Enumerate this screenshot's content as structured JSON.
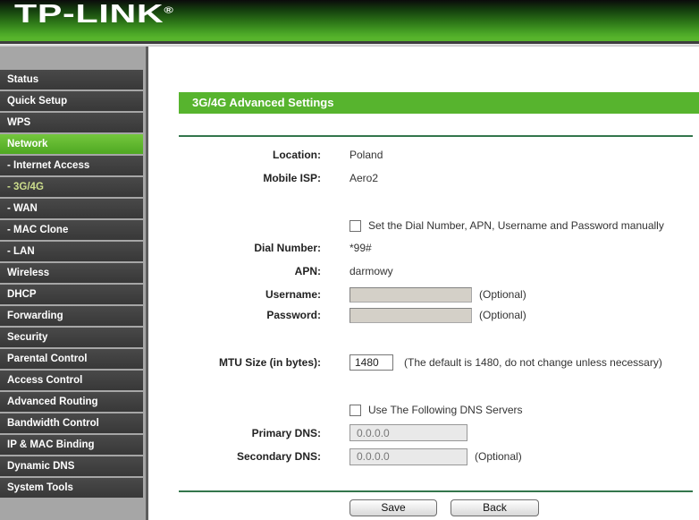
{
  "brand": {
    "logo": "TP-LINK",
    "trademark": "®"
  },
  "sidebar": {
    "items": [
      {
        "id": "status",
        "label": "Status"
      },
      {
        "id": "quick-setup",
        "label": "Quick Setup"
      },
      {
        "id": "wps",
        "label": "WPS"
      },
      {
        "id": "network",
        "label": "Network",
        "active": true
      },
      {
        "id": "internet-access",
        "label": "- Internet Access"
      },
      {
        "id": "3g4g",
        "label": "- 3G/4G",
        "subactive": true
      },
      {
        "id": "wan",
        "label": "- WAN"
      },
      {
        "id": "mac-clone",
        "label": "- MAC Clone"
      },
      {
        "id": "lan",
        "label": "- LAN"
      },
      {
        "id": "wireless",
        "label": "Wireless"
      },
      {
        "id": "dhcp",
        "label": "DHCP"
      },
      {
        "id": "forwarding",
        "label": "Forwarding"
      },
      {
        "id": "security",
        "label": "Security"
      },
      {
        "id": "parental-control",
        "label": "Parental Control"
      },
      {
        "id": "access-control",
        "label": "Access Control"
      },
      {
        "id": "advanced-routing",
        "label": "Advanced Routing"
      },
      {
        "id": "bandwidth-control",
        "label": "Bandwidth Control"
      },
      {
        "id": "ip-mac-binding",
        "label": "IP & MAC Binding"
      },
      {
        "id": "dynamic-dns",
        "label": "Dynamic DNS"
      },
      {
        "id": "system-tools",
        "label": "System Tools"
      }
    ]
  },
  "page": {
    "title": "3G/4G Advanced Settings"
  },
  "form": {
    "location": {
      "label": "Location:",
      "value": "Poland"
    },
    "mobile_isp": {
      "label": "Mobile ISP:",
      "value": "Aero2"
    },
    "manual_checkbox": {
      "label": "Set the Dial Number, APN, Username and Password manually",
      "checked": false
    },
    "dial_number": {
      "label": "Dial Number:",
      "value": "*99#"
    },
    "apn": {
      "label": "APN:",
      "value": "darmowy"
    },
    "username": {
      "label": "Username:",
      "value": "",
      "note": "(Optional)"
    },
    "password": {
      "label": "Password:",
      "value": "",
      "note": "(Optional)"
    },
    "mtu": {
      "label": "MTU Size (in bytes):",
      "value": "1480",
      "note": "(The default is 1480, do not change unless necessary)"
    },
    "dns_checkbox": {
      "label": "Use The Following DNS Servers",
      "checked": false
    },
    "primary_dns": {
      "label": "Primary DNS:",
      "value": "0.0.0.0"
    },
    "secondary_dns": {
      "label": "Secondary DNS:",
      "value": "0.0.0.0",
      "note": "(Optional)"
    },
    "buttons": {
      "save": "Save",
      "back": "Back"
    }
  }
}
